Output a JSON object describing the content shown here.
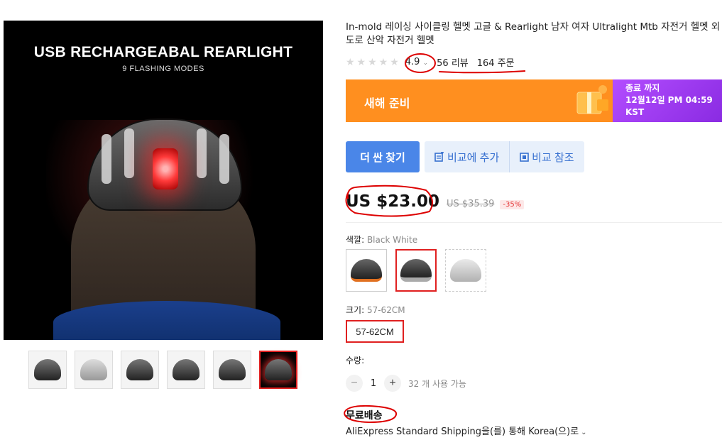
{
  "gallery": {
    "main_image_title": "USB RECHARGEABAL REARLIGHT",
    "main_image_subtitle": "9 FLASHING MODES",
    "thumbnail_count": 6,
    "active_thumbnail": 6
  },
  "product": {
    "title": "In-mold 레이싱 사이클링 헬멧 고글 & Rearlight 남자 여자 Ultralight Mtb 자전거 헬멧 외 도로 산악 자전거 헬멧",
    "rating": "4.9",
    "reviews": "56 리뷰",
    "orders": "164 주문"
  },
  "banner": {
    "title": "새해 준비",
    "end_label": "종료 까지",
    "end_time": "12월12일 PM 04:59",
    "timezone": "KST",
    "bg_color": "#ff8f1f",
    "right_color": "#8a2be2"
  },
  "actions": {
    "find_cheaper": "더 싼 찾기",
    "add_compare": "비교에 추가",
    "view_compare": "비교 참조"
  },
  "price": {
    "current": "US $23.00",
    "original": "US $35.39",
    "discount": "-35%"
  },
  "color": {
    "label": "색깔: ",
    "selected": "Black White"
  },
  "size": {
    "label": "크기: ",
    "selected": "57-62CM",
    "option": "57-62CM"
  },
  "quantity": {
    "label": "수량:",
    "minus": "−",
    "value": "1",
    "plus": "+",
    "available": "32 개 사용 가능"
  },
  "shipping": {
    "title": "무료배송",
    "method": "AliExpress Standard Shipping을(를) 통해 Korea(으)로",
    "chevron": "⌄"
  },
  "stars": "★★★★★"
}
